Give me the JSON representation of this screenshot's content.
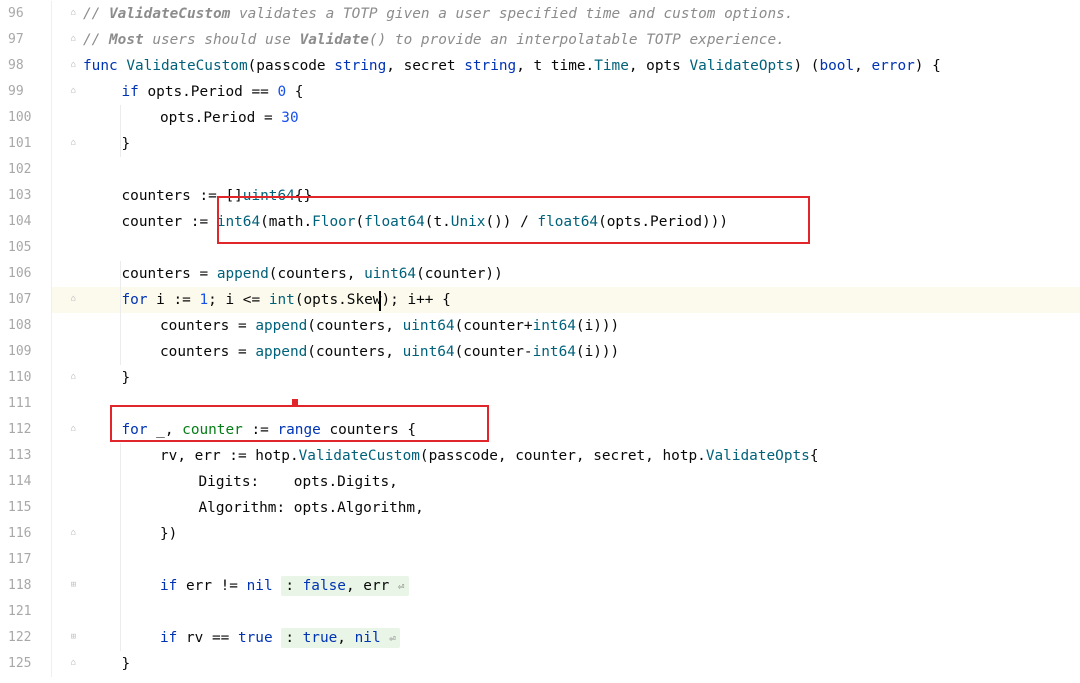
{
  "editor": {
    "lines": [
      {
        "number": "96",
        "text": "// ValidateCustom validates a TOTP given a user specified time and custom options."
      },
      {
        "number": "97",
        "text": "// Most users should use Validate() to provide an interpolatable TOTP experience."
      },
      {
        "number": "98",
        "text": "func ValidateCustom(passcode string, secret string, t time.Time, opts ValidateOpts) (bool, error) {"
      },
      {
        "number": "99",
        "text": "if opts.Period == 0 {"
      },
      {
        "number": "100",
        "text": "opts.Period = 30"
      },
      {
        "number": "101",
        "text": "}"
      },
      {
        "number": "102",
        "text": ""
      },
      {
        "number": "103",
        "text": "counters := []uint64{}"
      },
      {
        "number": "104",
        "text": "counter := int64(math.Floor(float64(t.Unix()) / float64(opts.Period)))"
      },
      {
        "number": "105",
        "text": ""
      },
      {
        "number": "106",
        "text": "counters = append(counters, uint64(counter))"
      },
      {
        "number": "107",
        "text": "for i := 1; i <= int(opts.Skew); i++ {"
      },
      {
        "number": "108",
        "text": "counters = append(counters, uint64(counter+int64(i)))"
      },
      {
        "number": "109",
        "text": "counters = append(counters, uint64(counter-int64(i)))"
      },
      {
        "number": "110",
        "text": "}"
      },
      {
        "number": "111",
        "text": ""
      },
      {
        "number": "112",
        "text": "for _, counter := range counters {"
      },
      {
        "number": "113",
        "text": "rv, err := hotp.ValidateCustom(passcode, counter, secret, hotp.ValidateOpts{"
      },
      {
        "number": "114",
        "text": "Digits:    opts.Digits,"
      },
      {
        "number": "115",
        "text": "Algorithm: opts.Algorithm,"
      },
      {
        "number": "116",
        "text": "})"
      },
      {
        "number": "117",
        "text": ""
      },
      {
        "number": "118",
        "text": "if err != nil : false, err"
      },
      {
        "number": "121",
        "text": ""
      },
      {
        "number": "122",
        "text": "if rv == true : true, nil"
      },
      {
        "number": "125",
        "text": "}"
      }
    ],
    "current_line": "107",
    "colors": {
      "keyword": "#0033b3",
      "function": "#00627a",
      "number": "#1750eb",
      "comment": "#8c8c8c",
      "highlight_box": "#e0262b",
      "current_line_bg": "#fcfaed",
      "fold_summary_bg": "#e9f5e6"
    }
  }
}
